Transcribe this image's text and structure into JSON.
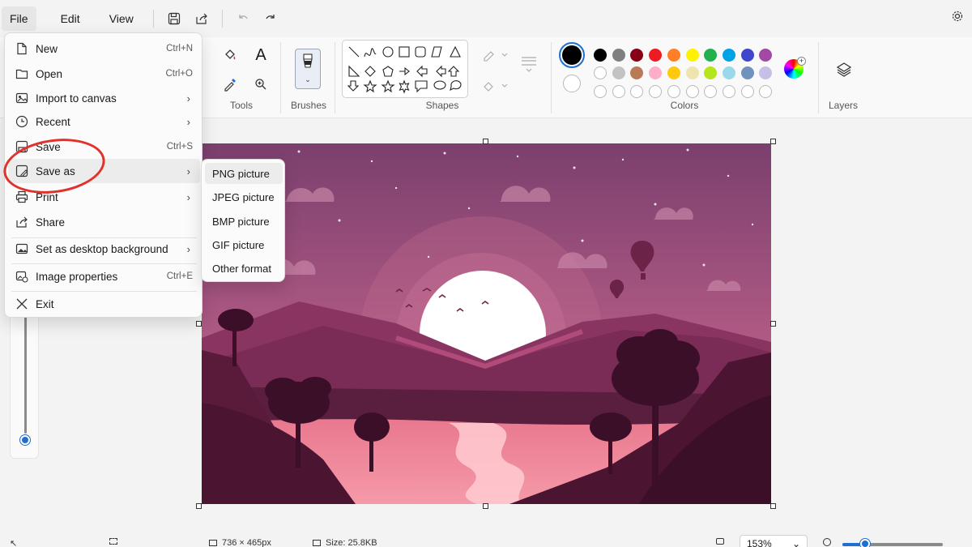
{
  "menubar": {
    "file": "File",
    "edit": "Edit",
    "view": "View"
  },
  "ribbon": {
    "tools_label": "Tools",
    "brushes_label": "Brushes",
    "shapes_label": "Shapes",
    "colors_label": "Colors",
    "layers_label": "Layers",
    "text_tool_glyph": "A"
  },
  "colors": {
    "primary": "#000000",
    "secondary": "#ffffff",
    "row1": [
      "#000000",
      "#7f7f7f",
      "#880015",
      "#ed1c24",
      "#ff7f27",
      "#fff200",
      "#22b14c",
      "#00a2e8",
      "#3f48cc",
      "#a349a4"
    ],
    "row2": [
      "#ffffff",
      "#c3c3c3",
      "#b97a57",
      "#ffaec9",
      "#ffc90e",
      "#efe4b0",
      "#b5e61d",
      "#99d9ea",
      "#7092be",
      "#c8bfe7"
    ],
    "row3_empty_count": 10
  },
  "file_menu": {
    "items": [
      {
        "label": "New",
        "shortcut": "Ctrl+N",
        "icon": "new-file-icon"
      },
      {
        "label": "Open",
        "shortcut": "Ctrl+O",
        "icon": "open-folder-icon"
      },
      {
        "label": "Import to canvas",
        "shortcut": "",
        "icon": "import-icon",
        "submenu": true
      },
      {
        "label": "Recent",
        "shortcut": "",
        "icon": "clock-icon",
        "submenu": true
      },
      {
        "label": "Save",
        "shortcut": "Ctrl+S",
        "icon": "save-icon"
      },
      {
        "label": "Save as",
        "shortcut": "",
        "icon": "save-as-icon",
        "submenu": true
      },
      {
        "label": "Print",
        "shortcut": "",
        "icon": "print-icon",
        "submenu": true
      },
      {
        "label": "Share",
        "shortcut": "",
        "icon": "share-icon"
      },
      {
        "label": "Set as desktop background",
        "shortcut": "",
        "icon": "desktop-background-icon",
        "submenu": true
      },
      {
        "label": "Image properties",
        "shortcut": "Ctrl+E",
        "icon": "image-properties-icon"
      },
      {
        "label": "Exit",
        "shortcut": "",
        "icon": "close-icon"
      }
    ]
  },
  "save_as_menu": {
    "items": [
      "PNG picture",
      "JPEG picture",
      "BMP picture",
      "GIF picture",
      "Other format"
    ]
  },
  "statusbar": {
    "dimensions": "736 × 465px",
    "size": "Size: 25.8KB",
    "zoom": "153%"
  }
}
